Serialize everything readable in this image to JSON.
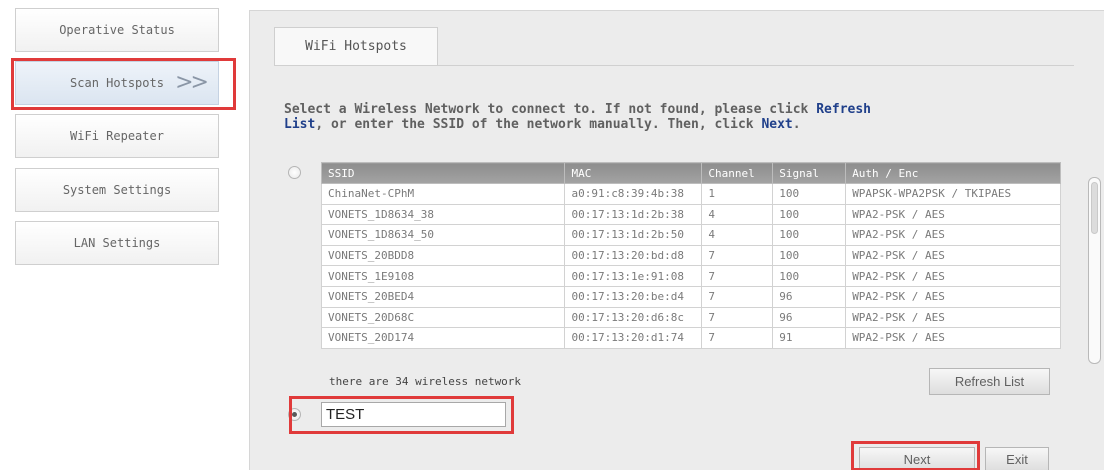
{
  "sidebar": {
    "items": [
      {
        "label": "Operative Status"
      },
      {
        "label": "Scan Hotspots",
        "arrow": ">>"
      },
      {
        "label": "WiFi Repeater"
      },
      {
        "label": "System Settings"
      },
      {
        "label": "LAN Settings"
      }
    ]
  },
  "main": {
    "tab_label": "WiFi Hotspots",
    "instruction": {
      "part1": "Select a Wireless Network to connect to. If not found, please click ",
      "refresh_kw": "Refresh",
      "line2_kw": "List",
      "part2": ", or enter the SSID of the network manually. Then, click ",
      "next_kw": "Next",
      "part3": "."
    }
  },
  "table": {
    "headers": {
      "ssid": "SSID",
      "mac": "MAC",
      "channel": "Channel",
      "signal": "Signal",
      "auth": "Auth / Enc"
    },
    "rows": [
      {
        "ssid": "ChinaNet-CPhM",
        "mac": "a0:91:c8:39:4b:38",
        "channel": "1",
        "signal": "100",
        "auth": "WPAPSK-WPA2PSK / TKIPAES"
      },
      {
        "ssid": "VONETS_1D8634_38",
        "mac": "00:17:13:1d:2b:38",
        "channel": "4",
        "signal": "100",
        "auth": "WPA2-PSK / AES"
      },
      {
        "ssid": "VONETS_1D8634_50",
        "mac": "00:17:13:1d:2b:50",
        "channel": "4",
        "signal": "100",
        "auth": "WPA2-PSK / AES"
      },
      {
        "ssid": "VONETS_20BDD8",
        "mac": "00:17:13:20:bd:d8",
        "channel": "7",
        "signal": "100",
        "auth": "WPA2-PSK / AES"
      },
      {
        "ssid": "VONETS_1E9108",
        "mac": "00:17:13:1e:91:08",
        "channel": "7",
        "signal": "100",
        "auth": "WPA2-PSK / AES"
      },
      {
        "ssid": "VONETS_20BED4",
        "mac": "00:17:13:20:be:d4",
        "channel": "7",
        "signal": "96",
        "auth": "WPA2-PSK / AES"
      },
      {
        "ssid": "VONETS_20D68C",
        "mac": "00:17:13:20:d6:8c",
        "channel": "7",
        "signal": "96",
        "auth": "WPA2-PSK / AES"
      },
      {
        "ssid": "VONETS_20D174",
        "mac": "00:17:13:20:d1:74",
        "channel": "7",
        "signal": "91",
        "auth": "WPA2-PSK / AES"
      }
    ]
  },
  "count_text": "there are 34 wireless network",
  "buttons": {
    "refresh": "Refresh List",
    "next": "Next",
    "exit": "Exit"
  },
  "manual_ssid": {
    "value": "TEST"
  },
  "colors": {
    "highlight": "#e03a3a",
    "keyword": "#1f3f8a"
  }
}
